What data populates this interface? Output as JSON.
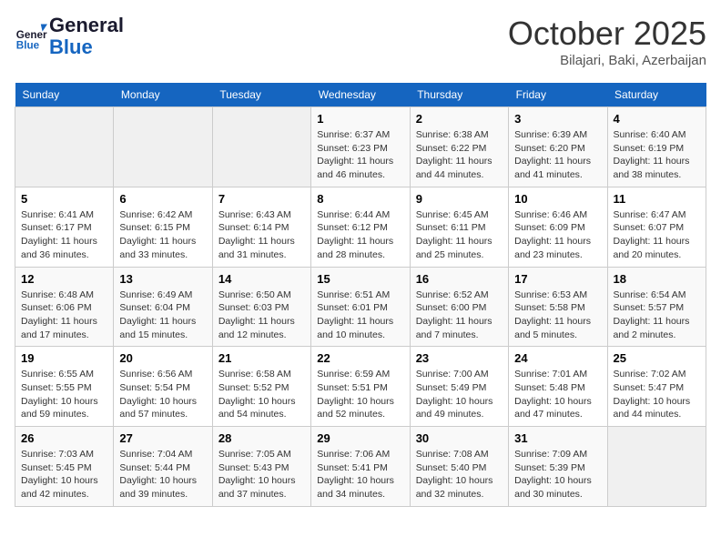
{
  "header": {
    "logo_line1": "General",
    "logo_line2": "Blue",
    "month": "October 2025",
    "location": "Bilajari, Baki, Azerbaijan"
  },
  "weekdays": [
    "Sunday",
    "Monday",
    "Tuesday",
    "Wednesday",
    "Thursday",
    "Friday",
    "Saturday"
  ],
  "weeks": [
    [
      {
        "day": "",
        "text": ""
      },
      {
        "day": "",
        "text": ""
      },
      {
        "day": "",
        "text": ""
      },
      {
        "day": "1",
        "text": "Sunrise: 6:37 AM\nSunset: 6:23 PM\nDaylight: 11 hours and 46 minutes."
      },
      {
        "day": "2",
        "text": "Sunrise: 6:38 AM\nSunset: 6:22 PM\nDaylight: 11 hours and 44 minutes."
      },
      {
        "day": "3",
        "text": "Sunrise: 6:39 AM\nSunset: 6:20 PM\nDaylight: 11 hours and 41 minutes."
      },
      {
        "day": "4",
        "text": "Sunrise: 6:40 AM\nSunset: 6:19 PM\nDaylight: 11 hours and 38 minutes."
      }
    ],
    [
      {
        "day": "5",
        "text": "Sunrise: 6:41 AM\nSunset: 6:17 PM\nDaylight: 11 hours and 36 minutes."
      },
      {
        "day": "6",
        "text": "Sunrise: 6:42 AM\nSunset: 6:15 PM\nDaylight: 11 hours and 33 minutes."
      },
      {
        "day": "7",
        "text": "Sunrise: 6:43 AM\nSunset: 6:14 PM\nDaylight: 11 hours and 31 minutes."
      },
      {
        "day": "8",
        "text": "Sunrise: 6:44 AM\nSunset: 6:12 PM\nDaylight: 11 hours and 28 minutes."
      },
      {
        "day": "9",
        "text": "Sunrise: 6:45 AM\nSunset: 6:11 PM\nDaylight: 11 hours and 25 minutes."
      },
      {
        "day": "10",
        "text": "Sunrise: 6:46 AM\nSunset: 6:09 PM\nDaylight: 11 hours and 23 minutes."
      },
      {
        "day": "11",
        "text": "Sunrise: 6:47 AM\nSunset: 6:07 PM\nDaylight: 11 hours and 20 minutes."
      }
    ],
    [
      {
        "day": "12",
        "text": "Sunrise: 6:48 AM\nSunset: 6:06 PM\nDaylight: 11 hours and 17 minutes."
      },
      {
        "day": "13",
        "text": "Sunrise: 6:49 AM\nSunset: 6:04 PM\nDaylight: 11 hours and 15 minutes."
      },
      {
        "day": "14",
        "text": "Sunrise: 6:50 AM\nSunset: 6:03 PM\nDaylight: 11 hours and 12 minutes."
      },
      {
        "day": "15",
        "text": "Sunrise: 6:51 AM\nSunset: 6:01 PM\nDaylight: 11 hours and 10 minutes."
      },
      {
        "day": "16",
        "text": "Sunrise: 6:52 AM\nSunset: 6:00 PM\nDaylight: 11 hours and 7 minutes."
      },
      {
        "day": "17",
        "text": "Sunrise: 6:53 AM\nSunset: 5:58 PM\nDaylight: 11 hours and 5 minutes."
      },
      {
        "day": "18",
        "text": "Sunrise: 6:54 AM\nSunset: 5:57 PM\nDaylight: 11 hours and 2 minutes."
      }
    ],
    [
      {
        "day": "19",
        "text": "Sunrise: 6:55 AM\nSunset: 5:55 PM\nDaylight: 10 hours and 59 minutes."
      },
      {
        "day": "20",
        "text": "Sunrise: 6:56 AM\nSunset: 5:54 PM\nDaylight: 10 hours and 57 minutes."
      },
      {
        "day": "21",
        "text": "Sunrise: 6:58 AM\nSunset: 5:52 PM\nDaylight: 10 hours and 54 minutes."
      },
      {
        "day": "22",
        "text": "Sunrise: 6:59 AM\nSunset: 5:51 PM\nDaylight: 10 hours and 52 minutes."
      },
      {
        "day": "23",
        "text": "Sunrise: 7:00 AM\nSunset: 5:49 PM\nDaylight: 10 hours and 49 minutes."
      },
      {
        "day": "24",
        "text": "Sunrise: 7:01 AM\nSunset: 5:48 PM\nDaylight: 10 hours and 47 minutes."
      },
      {
        "day": "25",
        "text": "Sunrise: 7:02 AM\nSunset: 5:47 PM\nDaylight: 10 hours and 44 minutes."
      }
    ],
    [
      {
        "day": "26",
        "text": "Sunrise: 7:03 AM\nSunset: 5:45 PM\nDaylight: 10 hours and 42 minutes."
      },
      {
        "day": "27",
        "text": "Sunrise: 7:04 AM\nSunset: 5:44 PM\nDaylight: 10 hours and 39 minutes."
      },
      {
        "day": "28",
        "text": "Sunrise: 7:05 AM\nSunset: 5:43 PM\nDaylight: 10 hours and 37 minutes."
      },
      {
        "day": "29",
        "text": "Sunrise: 7:06 AM\nSunset: 5:41 PM\nDaylight: 10 hours and 34 minutes."
      },
      {
        "day": "30",
        "text": "Sunrise: 7:08 AM\nSunset: 5:40 PM\nDaylight: 10 hours and 32 minutes."
      },
      {
        "day": "31",
        "text": "Sunrise: 7:09 AM\nSunset: 5:39 PM\nDaylight: 10 hours and 30 minutes."
      },
      {
        "day": "",
        "text": ""
      }
    ]
  ]
}
